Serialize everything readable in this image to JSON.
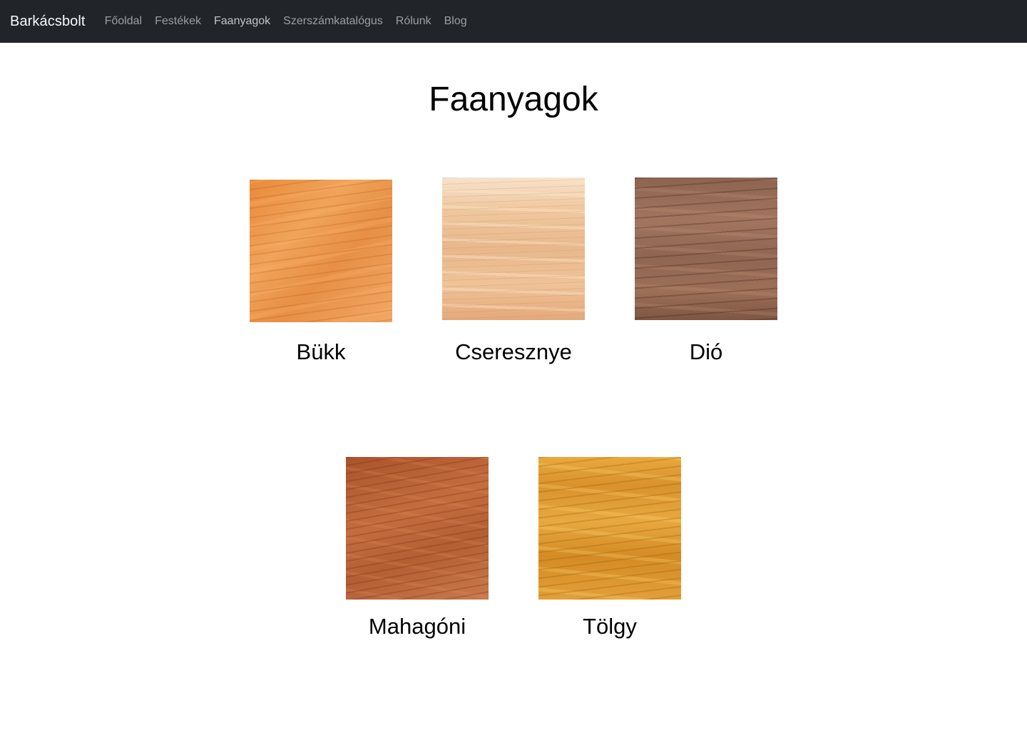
{
  "navbar": {
    "brand": "Barkácsbolt",
    "links": [
      {
        "label": "Főoldal",
        "active": false
      },
      {
        "label": "Festékek",
        "active": false
      },
      {
        "label": "Faanyagok",
        "active": true
      },
      {
        "label": "Szerszámkatalógus",
        "active": false
      },
      {
        "label": "Rólunk",
        "active": false
      },
      {
        "label": "Blog",
        "active": false
      }
    ],
    "background": "#212529"
  },
  "main": {
    "title": "Faanyagok",
    "woods": [
      {
        "name": "Bükk",
        "texture": "beech-wood-texture"
      },
      {
        "name": "Cseresznye",
        "texture": "cherry-wood-texture"
      },
      {
        "name": "Dió",
        "texture": "walnut-wood-texture"
      },
      {
        "name": "Mahagóni",
        "texture": "mahogany-wood-texture"
      },
      {
        "name": "Tölgy",
        "texture": "oak-wood-texture"
      }
    ]
  }
}
